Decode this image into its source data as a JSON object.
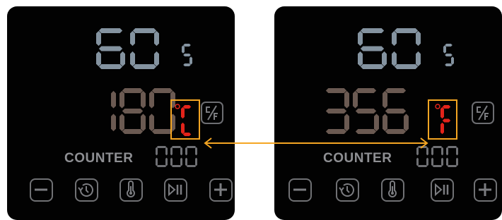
{
  "colors": {
    "timer_digits": "#8493a0",
    "temp_digits": "#6b5a52",
    "unit_active": "#e2231a",
    "unit_highlight_box": "#f5a623",
    "counter_digits": "#6f7074",
    "button_outline": "#707174",
    "panel_background": "#020202"
  },
  "panels": [
    {
      "id": "celsius",
      "timer": {
        "value": "60",
        "unit": "s"
      },
      "temperature": {
        "value": "180",
        "unit": "C"
      },
      "counter": {
        "label": "COUNTER",
        "value": "000"
      }
    },
    {
      "id": "fahrenheit",
      "timer": {
        "value": "60",
        "unit": "s"
      },
      "temperature": {
        "value": "356",
        "unit": "F"
      },
      "counter": {
        "label": "COUNTER",
        "value": "000"
      }
    }
  ],
  "controls": {
    "buttons": [
      "minus-icon",
      "timer-icon",
      "thermometer-icon",
      "play-pause-icon",
      "plus-icon"
    ],
    "unit_toggle": "celsius-fahrenheit-toggle-icon"
  }
}
